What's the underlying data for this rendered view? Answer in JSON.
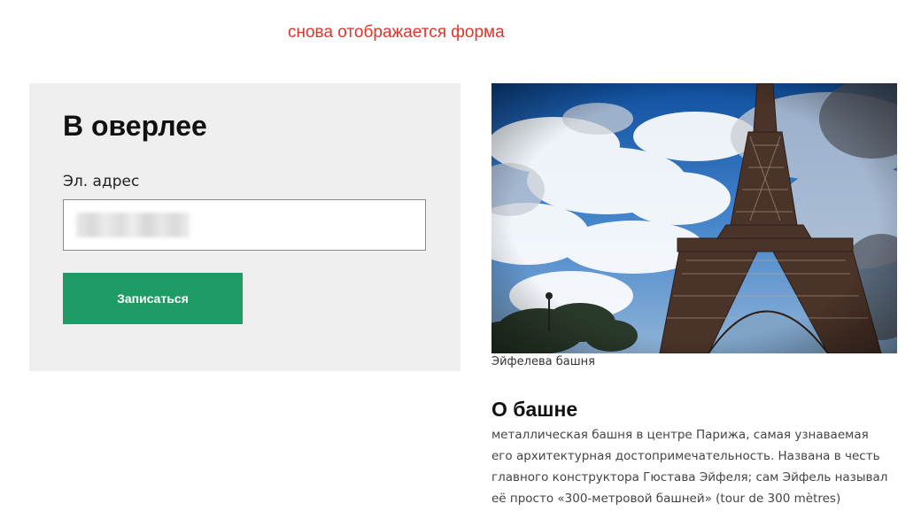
{
  "annotation": "снова отображается форма",
  "form": {
    "title": "В оверлее",
    "email_label": "Эл. адрес",
    "email_value": "",
    "submit_label": "Записаться"
  },
  "media": {
    "image_subject": "eiffel-tower",
    "caption": "Эйфелева башня"
  },
  "about": {
    "title": "О башне",
    "lines": [
      "металлическая башня в центре Парижа, самая узнаваемая",
      "его архитектурная достопримечательность. Названа в честь",
      "главного конструктора Гюстава Эйфеля; сам Эйфель называл",
      "её просто «300-метровой башней» (tour de 300 mètres)"
    ]
  },
  "colors": {
    "annotation": "#e0342b",
    "card_background": "#efefef",
    "button": "#1f9c66"
  }
}
